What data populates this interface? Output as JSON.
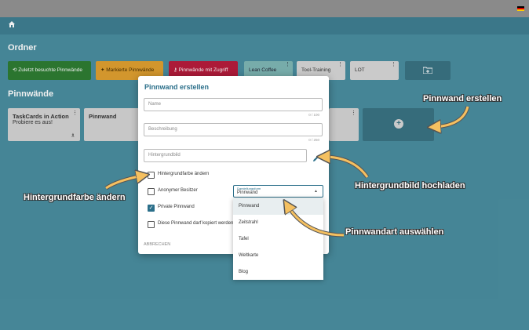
{
  "header": {
    "flag_icon": "german-flag-icon",
    "home_icon": "home-icon"
  },
  "folders": {
    "title": "Ordner",
    "tiles": [
      {
        "label": "Zuletzt besuchte Pinnwände",
        "color": "#2e7d32",
        "icon": "history-icon"
      },
      {
        "label": "Markierte Pinnwände",
        "color": "#e0a030",
        "icon": "pin-icon"
      },
      {
        "label": "Pinnwände mit Zugriff",
        "color": "#b71c3c",
        "icon": "key-icon"
      },
      {
        "label": "Lean Coffee",
        "color": "#7fb7b5"
      },
      {
        "label": "Tool-Training",
        "color": "#d7d7d7"
      },
      {
        "label": "LOT",
        "color": "#d7d7d7"
      }
    ],
    "add_folder_icon": "folder-add-icon"
  },
  "boards": {
    "title": "Pinnwände",
    "cards": [
      {
        "title": "TaskCards in Action",
        "subtitle": "Probiere es aus!"
      },
      {
        "title": "Pinnwand",
        "subtitle": ""
      }
    ],
    "add_icon": "plus-icon"
  },
  "dialog": {
    "title": "Pinnwand erstellen",
    "name_placeholder": "Name",
    "name_counter": "0 / 100",
    "desc_placeholder": "Beschreibung",
    "desc_counter": "0 / 250",
    "bg_placeholder": "Hintergrundbild",
    "edit_icon": "pencil-icon",
    "checkboxes": [
      {
        "label": "Hintergrundfarbe ändern",
        "checked": false
      },
      {
        "label": "Anonymer Besitzer",
        "checked": false
      },
      {
        "label": "Private Pinnwand",
        "checked": true
      },
      {
        "label": "Diese Pinnwand darf kopiert werden",
        "checked": false
      }
    ],
    "cancel_label": "ABBRECHEN",
    "select": {
      "label": "Darstellungsform",
      "value": "Pinnwand",
      "options": [
        "Pinnwand",
        "Zeitstrahl",
        "Tafel",
        "Weltkarte",
        "Blog"
      ]
    }
  },
  "annotations": {
    "create": "Pinnwand erstellen",
    "bg_color": "Hintergrundfarbe ändern",
    "bg_image": "Hintergrundbild hochladen",
    "board_type": "Pinnwandart auswählen",
    "color": "#f5c060"
  }
}
